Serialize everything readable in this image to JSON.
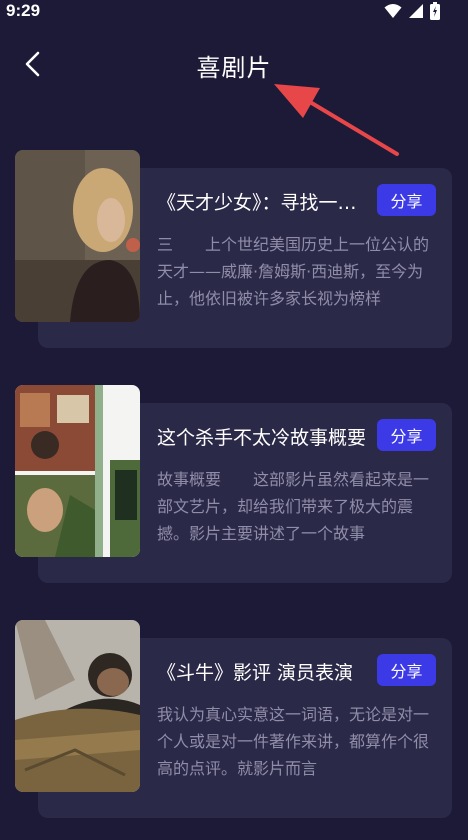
{
  "status_bar": {
    "time": "9:29"
  },
  "header": {
    "title": "喜剧片"
  },
  "cards": [
    {
      "title": "《天才少女》：寻找一部好电影",
      "share_label": "分享",
      "description": "三　　上个世纪美国历史上一位公认的天才——威廉·詹姆斯·西迪斯，至今为止，他依旧被许多家长视为榜样"
    },
    {
      "title": "这个杀手不太冷故事概要",
      "share_label": "分享",
      "description": "故事概要　　这部影片虽然看起来是一部文艺片，却给我们带来了极大的震撼。影片主要讲述了一个故事"
    },
    {
      "title": "《斗牛》影评 演员表演",
      "share_label": "分享",
      "description": "我认为真心实意这一词语，无论是对一个人或是对一件著作来讲，都算作个很高的点评。就影片而言"
    }
  ],
  "colors": {
    "background": "#1d1a37",
    "card": "#2b2948",
    "share_button": "#3c39e6",
    "annotation_arrow": "#e8474a"
  }
}
